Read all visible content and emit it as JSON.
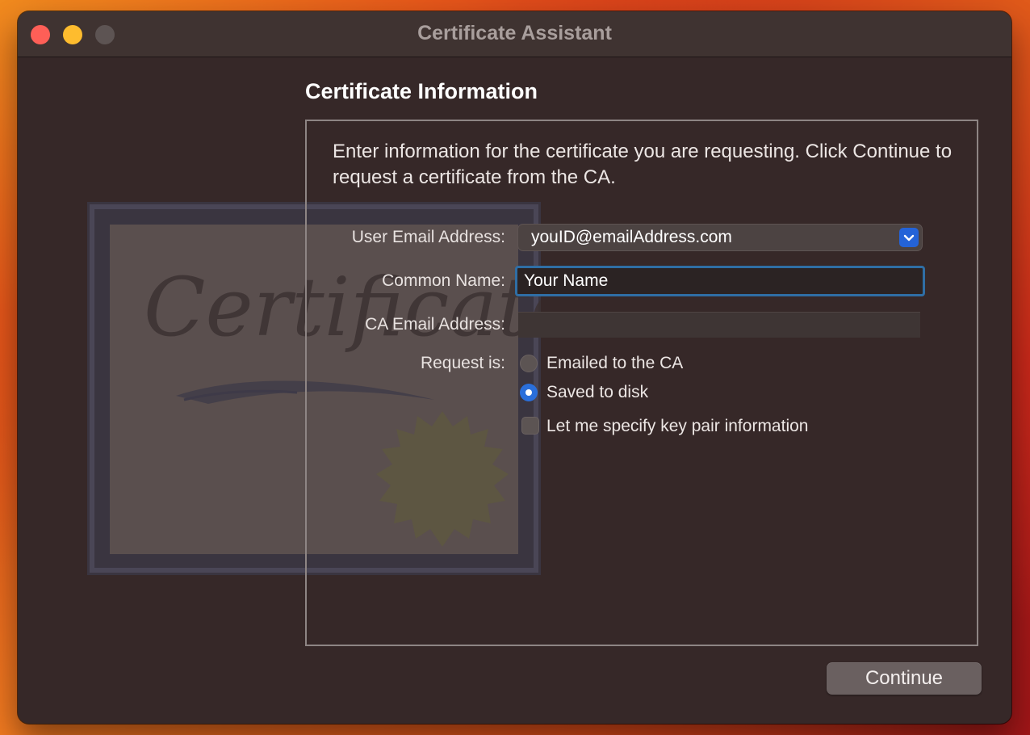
{
  "window": {
    "title": "Certificate Assistant"
  },
  "background_art": {
    "logo_text": "Certificate",
    "description": "Decorative certificate illustration with seal"
  },
  "heading": "Certificate Information",
  "intro": "Enter information for the certificate you are requesting. Click Continue to request a certificate from the CA.",
  "form": {
    "user_email_label": "User Email Address:",
    "user_email_value": "youID@emailAddress.com",
    "common_name_label": "Common Name:",
    "common_name_value": "Your Name",
    "ca_email_label": "CA Email Address:",
    "ca_email_value": "",
    "request_label": "Request is:",
    "options": [
      {
        "label": "Emailed to the CA",
        "selected": false
      },
      {
        "label": "Saved to disk",
        "selected": true
      }
    ],
    "keypair_label": "Let me specify key pair information",
    "keypair_checked": false
  },
  "buttons": {
    "continue": "Continue"
  },
  "colors": {
    "accent": "#2a6fdb",
    "focus_ring": "#2f6ea5",
    "close": "#fe5f57",
    "minimize": "#febc2e"
  }
}
